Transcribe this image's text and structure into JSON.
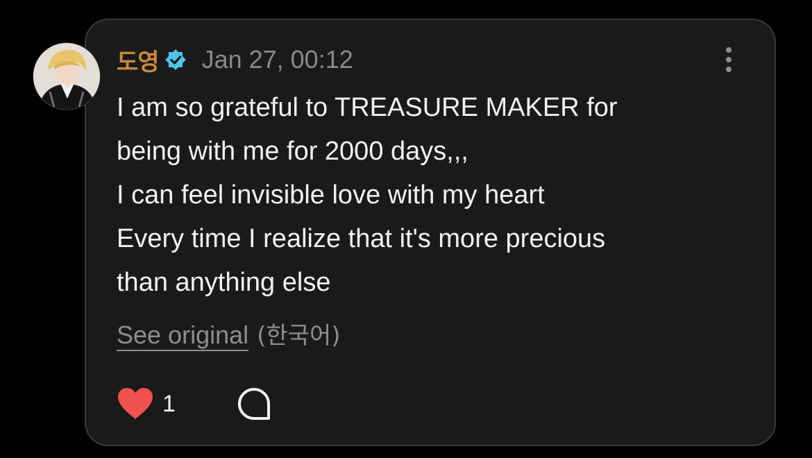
{
  "post": {
    "author": "도영",
    "verified": true,
    "timestamp": "Jan 27, 00:12",
    "body_lines": [
      "I am so grateful to TREASURE MAKER for",
      "being with me for 2000 days,,,",
      "I can feel invisible love with my heart",
      "Every time I realize that it's more precious",
      "than anything else"
    ],
    "translation": {
      "link_label": "See original",
      "language": "(한국어)"
    },
    "likes": "1"
  },
  "icons": {
    "avatar": "profile-photo",
    "verified": "verified-badge-icon",
    "more": "more-vertical-icon",
    "like": "heart-icon",
    "comment": "comment-bubble-icon"
  },
  "colors": {
    "author": "#c98a3b",
    "verified_badge": "#4fc3e8",
    "heart": "#f0524f",
    "card_bg": "#1a1a1a",
    "card_border": "#3a3a3a"
  }
}
